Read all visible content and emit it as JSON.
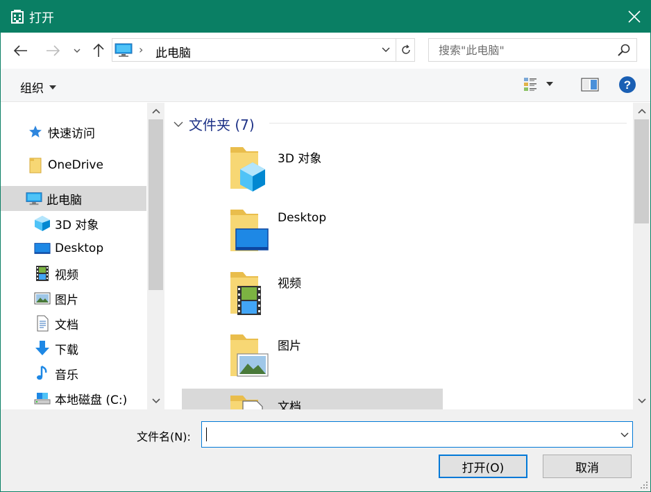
{
  "window": {
    "title": "打开",
    "accent": "#0a7f64"
  },
  "navigation": {
    "breadcrumb": "此电脑",
    "search_placeholder": "搜索\"此电脑\""
  },
  "commands": {
    "organize": "组织"
  },
  "sidebar": {
    "items": [
      {
        "label": "快速访问",
        "icon": "star-icon"
      },
      {
        "label": "OneDrive",
        "icon": "onedrive-folder-icon"
      },
      {
        "label": "此电脑",
        "icon": "computer-icon"
      },
      {
        "label": "3D 对象",
        "icon": "3d-objects-icon"
      },
      {
        "label": "Desktop",
        "icon": "desktop-icon"
      },
      {
        "label": "视频",
        "icon": "video-icon"
      },
      {
        "label": "图片",
        "icon": "pictures-icon"
      },
      {
        "label": "文档",
        "icon": "documents-icon"
      },
      {
        "label": "下载",
        "icon": "download-icon"
      },
      {
        "label": "音乐",
        "icon": "music-icon"
      },
      {
        "label": "本地磁盘 (C:)",
        "icon": "drive-icon"
      }
    ]
  },
  "content": {
    "group_header": "文件夹 (7)",
    "folders": [
      {
        "label": "3D 对象",
        "icon": "3d-objects-folder-icon"
      },
      {
        "label": "Desktop",
        "icon": "desktop-folder-icon"
      },
      {
        "label": "视频",
        "icon": "videos-folder-icon"
      },
      {
        "label": "图片",
        "icon": "pictures-folder-icon"
      },
      {
        "label": "文档",
        "icon": "documents-folder-icon"
      }
    ]
  },
  "footer": {
    "filename_label": "文件名(N):",
    "filename_value": "",
    "open_button": "打开(O)",
    "cancel_button": "取消"
  }
}
